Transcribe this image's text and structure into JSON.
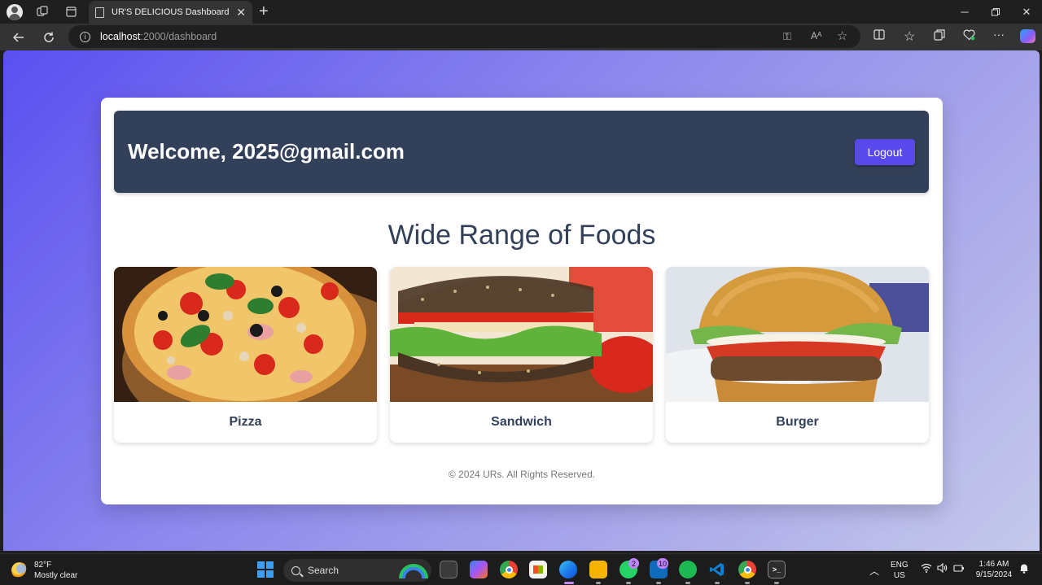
{
  "browser": {
    "tab_title": "UR'S DELICIOUS Dashboard",
    "url_host": "localhost",
    "url_path": ":2000/dashboard"
  },
  "page": {
    "welcome": "Welcome, 2025@gmail.com",
    "logout_label": "Logout",
    "section_title": "Wide Range of Foods",
    "foods": [
      {
        "name": "Pizza"
      },
      {
        "name": "Sandwich"
      },
      {
        "name": "Burger"
      }
    ],
    "footer": "© 2024 URs. All Rights Reserved."
  },
  "colors": {
    "header_bg": "#334059",
    "button_bg": "#5949ec",
    "gradient_start": "#5b4ff0",
    "gradient_end": "#c5c9eb"
  },
  "taskbar": {
    "temperature": "82°F",
    "condition": "Mostly clear",
    "search_placeholder": "Search",
    "whatsapp_badge": "2",
    "mail_badge": "10",
    "lang_line1": "ENG",
    "lang_line2": "US",
    "time": "1:46 AM",
    "date": "9/15/2024"
  },
  "icons": [
    "profile-icon",
    "workspaces-icon",
    "tab-actions-icon",
    "page-icon",
    "close-icon",
    "plus-icon",
    "minimize-icon",
    "maximize-icon",
    "window-close-icon",
    "back-icon",
    "refresh-icon",
    "info-icon",
    "key-icon",
    "read-aloud-icon",
    "star-icon",
    "split-screen-icon",
    "favorites-icon",
    "collections-icon",
    "health-icon",
    "more-icon",
    "copilot-icon",
    "weather-icon",
    "windows-start-icon",
    "search-icon",
    "task-view-icon",
    "copilot-app-icon",
    "chrome-icon",
    "store-icon",
    "edge-icon",
    "file-explorer-icon",
    "whatsapp-icon",
    "mail-icon",
    "spotify-icon",
    "vscode-icon",
    "chrome-alt-icon",
    "terminal-icon",
    "chevron-up-icon",
    "wifi-icon",
    "volume-icon",
    "battery-icon",
    "notification-bell-icon"
  ]
}
